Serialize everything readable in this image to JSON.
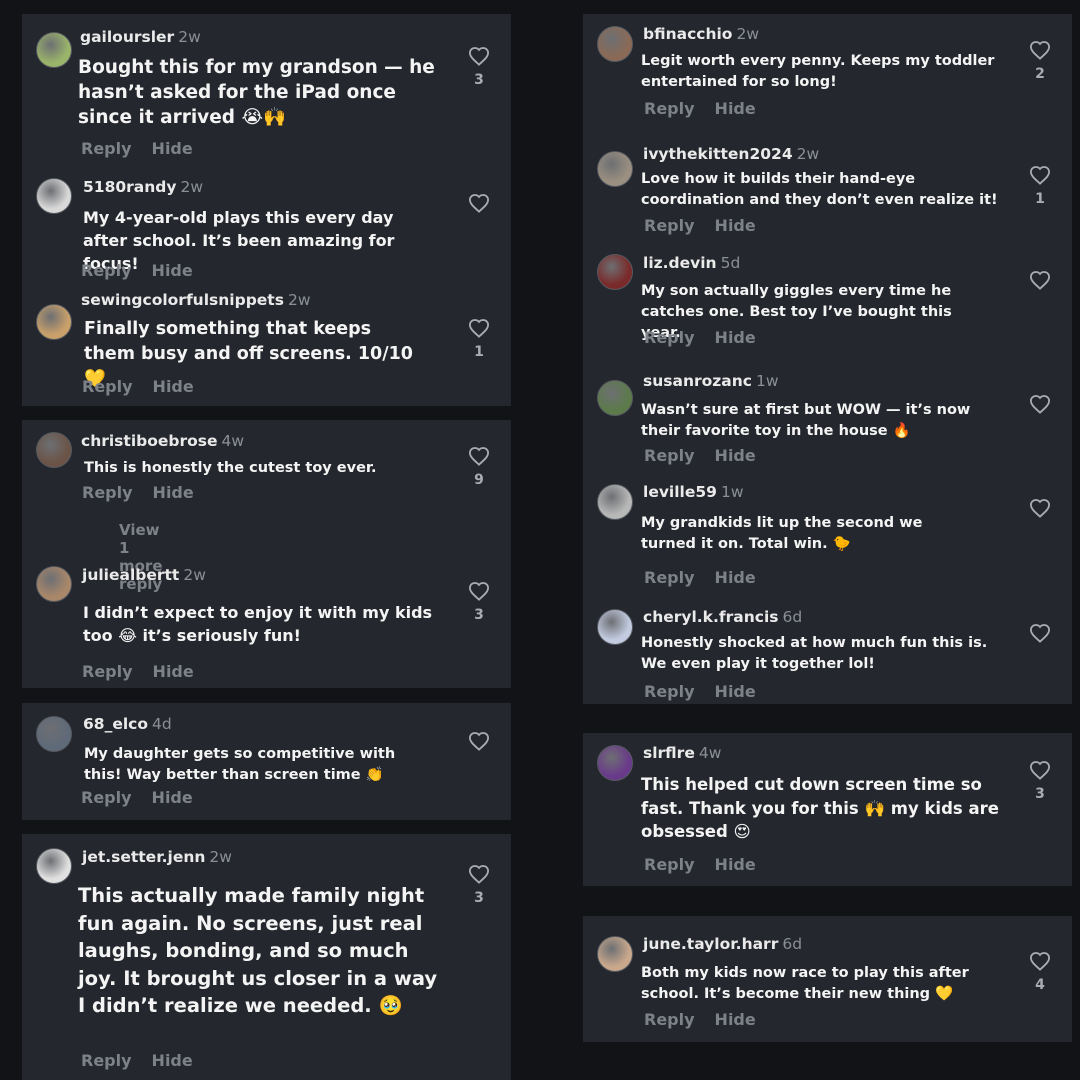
{
  "actions": {
    "reply": "Reply",
    "hide": "Hide"
  },
  "view_more_reply": "View 1 more reply",
  "comments": [
    {
      "user": "gailoursler",
      "ago": "2w",
      "text": "Bought this for my grandson — he hasn’t asked for the iPad once since it arrived 😭🙌",
      "likes": "3",
      "avatar_color": "#9ab46a"
    },
    {
      "user": "5180randy",
      "ago": "2w",
      "text": "My 4-year-old plays this every day after school. It’s been amazing for focus!",
      "likes": "",
      "avatar_color": "#d8d8d8"
    },
    {
      "user": "sewingcolorfulsnippets",
      "ago": "2w",
      "text": "Finally something that keeps them busy and off screens. 10/10 💛",
      "likes": "1",
      "avatar_color": "#c9a06a"
    },
    {
      "user": "christiboebrose",
      "ago": "4w",
      "text": "This is honestly the cutest toy ever.",
      "likes": "9",
      "avatar_color": "#6b5447"
    },
    {
      "user": "juliealbertt",
      "ago": "2w",
      "text": "I didn’t expect to enjoy it with my kids too 😂 it’s seriously fun!",
      "likes": "3",
      "avatar_color": "#a9876a"
    },
    {
      "user": "68_elco",
      "ago": "4d",
      "text": "My daughter gets so competitive with this! Way better than screen time 👏",
      "likes": "",
      "avatar_color": "#5f6a78"
    },
    {
      "user": "jet.setter.jenn",
      "ago": "2w",
      "text": "This actually made family night fun again. No screens, just real laughs, bonding, and so much joy. It brought us closer in a way I didn’t realize we needed. 🥹",
      "likes": "3",
      "avatar_color": "#e0e0e0"
    },
    {
      "user": "bfinacchio",
      "ago": "2w",
      "text": "Legit worth every penny. Keeps my toddler entertained for so long!",
      "likes": "2",
      "avatar_color": "#8a6a56"
    },
    {
      "user": "ivythekitten2024",
      "ago": "2w",
      "text": "Love how it builds their hand-eye coordination and they don’t even realize it!",
      "likes": "1",
      "avatar_color": "#9a8f80"
    },
    {
      "user": "liz.devin",
      "ago": "5d",
      "text": "My son actually giggles every time he catches one. Best toy I’ve bought this year.",
      "likes": "",
      "avatar_color": "#7a2a2a"
    },
    {
      "user": "susanrozanc",
      "ago": "1w",
      "text": "Wasn’t sure at first but WOW — it’s now their favorite toy in the house 🔥",
      "likes": "",
      "avatar_color": "#5c7a4a"
    },
    {
      "user": "leville59",
      "ago": "1w",
      "text": "My grandkids lit up the second we turned it on. Total win. 🐤",
      "likes": "",
      "avatar_color": "#b8b8b8"
    },
    {
      "user": "cheryl.k.francis",
      "ago": "6d",
      "text": "Honestly shocked at how much fun this is. We even play it together lol!",
      "likes": "",
      "avatar_color": "#c2cbe0"
    },
    {
      "user": "slrflre",
      "ago": "4w",
      "text": "This helped cut down screen time so fast. Thank you for this 🙌 my kids are obsessed 😍",
      "likes": "3",
      "avatar_color": "#6a3a8a"
    },
    {
      "user": "june.taylor.harr",
      "ago": "6d",
      "text": "Both my kids now race to play this after school. It’s become their new thing 💛",
      "likes": "4",
      "avatar_color": "#c9a88c"
    }
  ]
}
